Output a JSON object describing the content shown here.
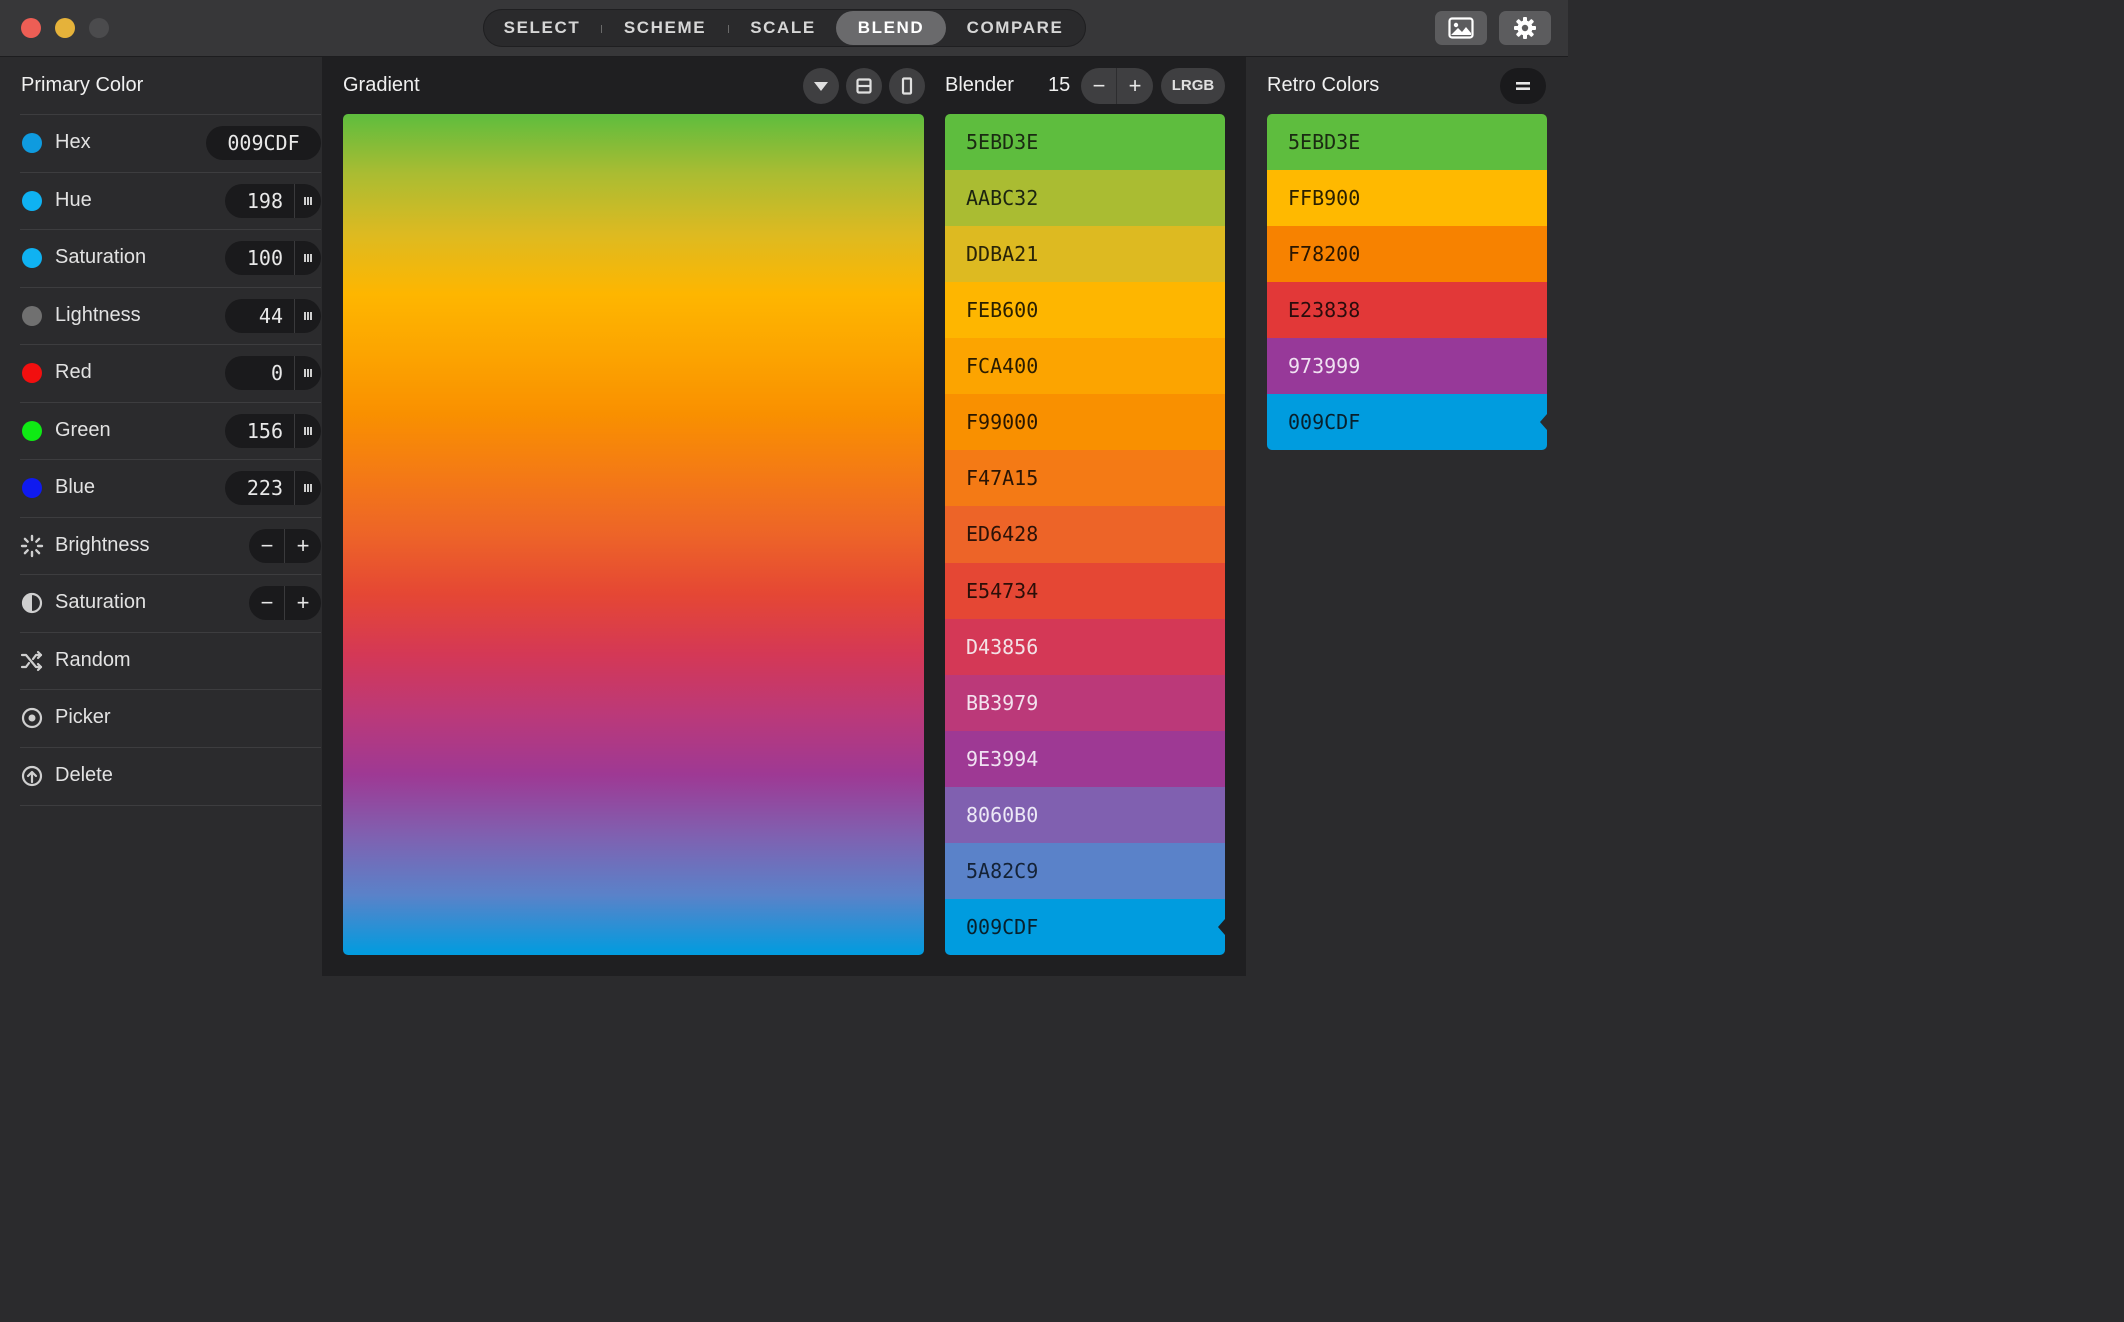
{
  "window": {
    "tabs": [
      {
        "label": "SELECT",
        "active": false
      },
      {
        "label": "SCHEME",
        "active": false
      },
      {
        "label": "SCALE",
        "active": false
      },
      {
        "label": "BLEND",
        "active": true
      },
      {
        "label": "COMPARE",
        "active": false
      }
    ],
    "traffic_lights": {
      "close": "#ED5E55",
      "minimize": "#E5B23A",
      "zoom": "#4B4B4D"
    },
    "toolbar_icons": [
      "image-icon",
      "gear-icon"
    ]
  },
  "primary": {
    "title": "Primary Color",
    "rows": [
      {
        "name": "Hex",
        "value": "009CDF",
        "dot": "#0F9BDF"
      },
      {
        "name": "Hue",
        "value": "198",
        "dot": "#0FB2F2"
      },
      {
        "name": "Saturation",
        "value": "100",
        "dot": "#0FB2F2"
      },
      {
        "name": "Lightness",
        "value": "44",
        "dot": "#707070"
      },
      {
        "name": "Red",
        "value": "0",
        "dot": "#F20F0F"
      },
      {
        "name": "Green",
        "value": "156",
        "dot": "#0FEA14"
      },
      {
        "name": "Blue",
        "value": "223",
        "dot": "#0F1AF0"
      }
    ],
    "adjust": [
      {
        "name": "Brightness",
        "minus": "−",
        "plus": "+"
      },
      {
        "name": "Saturation",
        "minus": "−",
        "plus": "+"
      }
    ],
    "actions": [
      {
        "name": "Random"
      },
      {
        "name": "Picker"
      },
      {
        "name": "Delete"
      }
    ]
  },
  "gradient": {
    "title": "Gradient",
    "icons": [
      "chevron-down-icon",
      "rows-icon",
      "column-icon"
    ]
  },
  "blender": {
    "title": "Blender",
    "count": "15",
    "minus": "−",
    "plus": "+",
    "mode": "LRGB",
    "colors": [
      "5EBD3E",
      "AABC32",
      "DDBA21",
      "FEB600",
      "FCA400",
      "F99000",
      "F47A15",
      "ED6428",
      "E54734",
      "D43856",
      "BB3979",
      "9E3994",
      "8060B0",
      "5A82C9",
      "009CDF"
    ],
    "text_colors": [
      "#1a2a12",
      "#1c2410",
      "#2a2408",
      "#2a2000",
      "#2a1c00",
      "#2a1700",
      "#2a1404",
      "#2b1208",
      "#2b0e08",
      "#f3e2e6",
      "#f3e2ee",
      "#f0e2f2",
      "#ece8f6",
      "#142236",
      "#08202c"
    ]
  },
  "retro": {
    "title": "Retro Colors",
    "menu_icon": "equals-icon",
    "colors": [
      "5EBD3E",
      "FFB900",
      "F78200",
      "E23838",
      "973999",
      "009CDF"
    ],
    "text_colors": [
      "#1a2a12",
      "#2a2000",
      "#2a1600",
      "#2b0c0c",
      "#f0e2f2",
      "#08202c"
    ]
  }
}
